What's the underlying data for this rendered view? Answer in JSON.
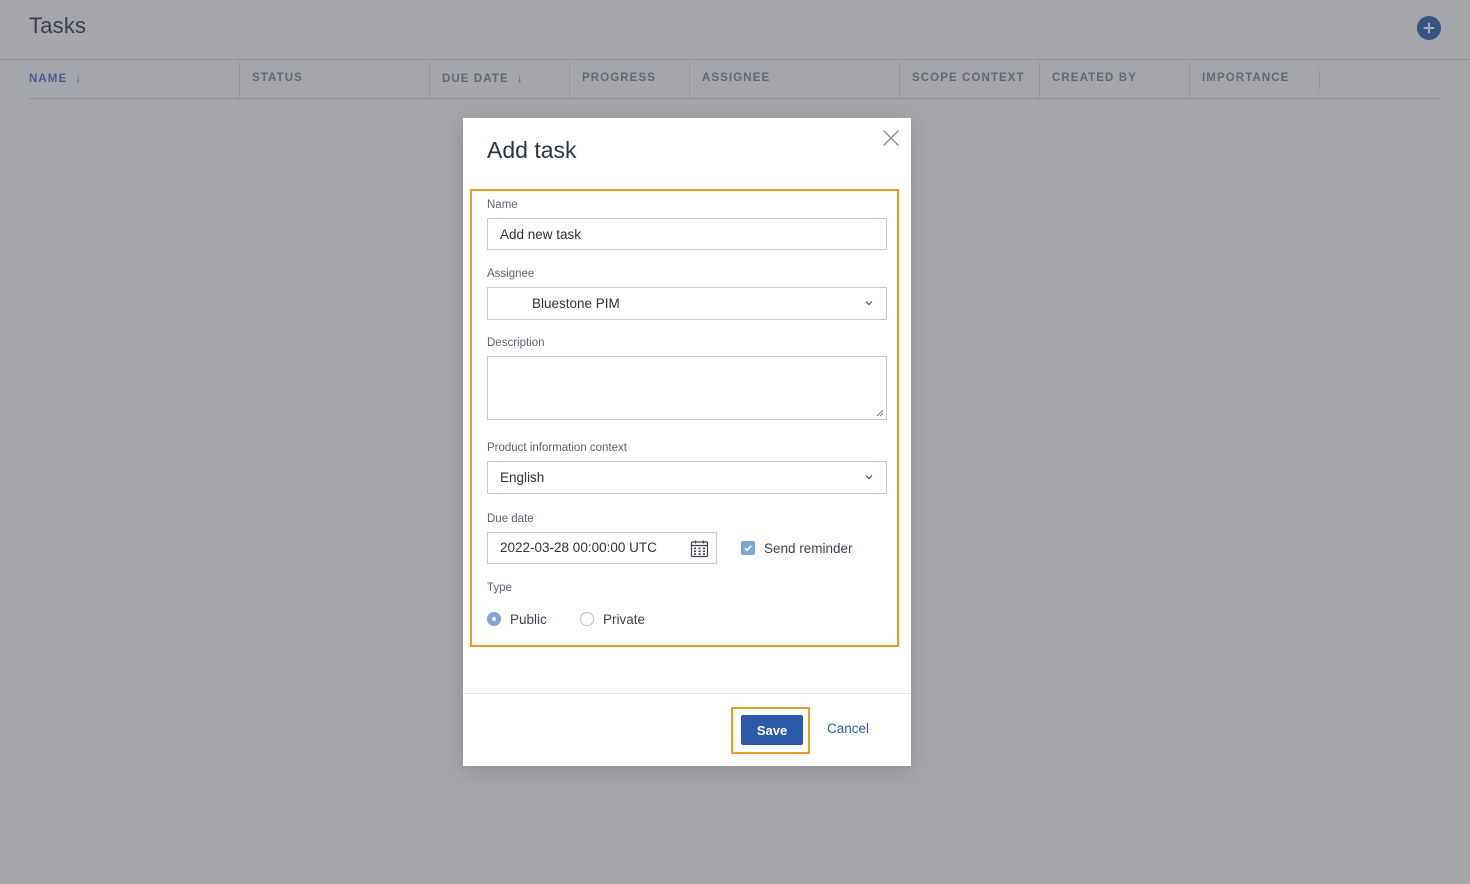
{
  "page": {
    "title": "Tasks",
    "columns": [
      "NAME",
      "STATUS",
      "DUE DATE",
      "PROGRESS",
      "ASSIGNEE",
      "SCOPE CONTEXT",
      "CREATED BY",
      "IMPORTANCE"
    ],
    "sort_arrow": "↓"
  },
  "modal": {
    "title": "Add task",
    "name_label": "Name",
    "name_value": "Add new task",
    "assignee_label": "Assignee",
    "assignee_value": "Bluestone PIM",
    "description_label": "Description",
    "description_value": "",
    "context_label": "Product information context",
    "context_value": "English",
    "due_label": "Due date",
    "due_value": "2022-03-28 00:00:00 UTC",
    "reminder_label": "Send reminder",
    "reminder_checked": true,
    "type_label": "Type",
    "type_public": "Public",
    "type_private": "Private",
    "type_selected": "Public",
    "save_label": "Save",
    "cancel_label": "Cancel"
  },
  "colors": {
    "primary": "#2d5aa8",
    "highlight": "#f39a26",
    "checkbox": "#7ea5d9"
  },
  "icons": [
    "add-icon",
    "sort-arrow-icon",
    "close-icon",
    "chevron-down-icon",
    "calendar-icon",
    "check-icon",
    "resize-grip-icon"
  ]
}
